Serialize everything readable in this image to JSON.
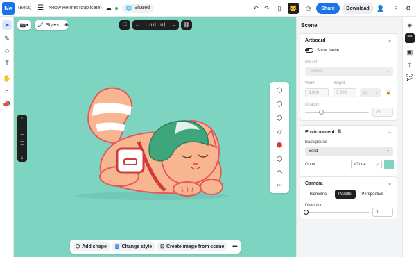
{
  "app": {
    "logo": "Ne",
    "beta": "(Beta)",
    "file_name": "Neow Helmet (duplicate)",
    "shared_label": "Shared",
    "share_label": "Share",
    "download_label": "Download",
    "accent": "#1a73e8"
  },
  "canvas": {
    "background": "#7dd4c0",
    "styles_label": "Styles",
    "bottom_bar": {
      "add_shape": "Add shape",
      "change_style": "Change style",
      "create_image": "Create image from scene",
      "more": "•••"
    }
  },
  "panel": {
    "title": "Scene",
    "artboard": {
      "header": "Artboard",
      "show_frame": "Show frame",
      "preset_label": "Preset",
      "preset_value": "Custom",
      "width_label": "Width",
      "width_value": "3,000",
      "height_label": "Height",
      "height_value": "3,000",
      "unit_value": "px",
      "opacity_label": "Opacity",
      "opacity_value": "25",
      "opacity_fraction": 0.25
    },
    "environment": {
      "header": "Environment",
      "background_label": "Background",
      "background_value": "Solid",
      "outer_label": "Outer",
      "outer_value": "#7dd4...",
      "outer_color": "#7dd4c0"
    },
    "camera": {
      "header": "Camera",
      "modes": [
        "Isometric",
        "Parallel",
        "Perspective"
      ],
      "selected_mode": "Parallel",
      "distortion_label": "Distortion",
      "distortion_value": "0",
      "distortion_fraction": 0
    }
  }
}
